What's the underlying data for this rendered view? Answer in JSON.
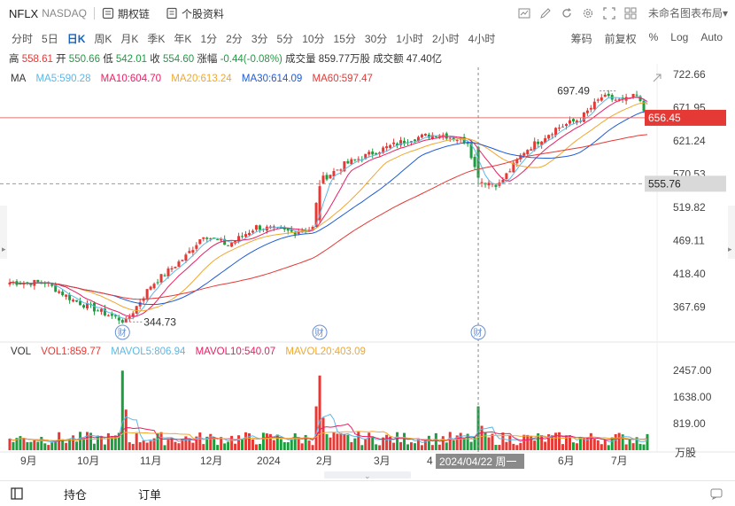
{
  "header": {
    "symbol": "NFLX",
    "exchange": "NASDAQ",
    "link1": "期权链",
    "link2": "个股资料",
    "layout_name": "未命名图表布局"
  },
  "periods": [
    "分时",
    "5日",
    "日K",
    "周K",
    "月K",
    "季K",
    "年K",
    "1分",
    "2分",
    "3分",
    "5分",
    "10分",
    "15分",
    "30分",
    "1小时",
    "2小时",
    "4小时"
  ],
  "active_period": "日K",
  "right_tools": [
    "筹码",
    "前复权",
    "%",
    "Log",
    "Auto"
  ],
  "ohlc": {
    "high_label": "高",
    "high": "558.61",
    "open_label": "开",
    "open": "550.66",
    "low_label": "低",
    "low": "542.01",
    "close_label": "收",
    "close": "554.60",
    "chg_label": "涨幅",
    "chg": "-0.44(-0.08%)",
    "vol_label": "成交量",
    "vol": "859.77万股",
    "amt_label": "成交额",
    "amt": "47.40亿"
  },
  "ma_legend": {
    "title": "MA",
    "ma5": "MA5:590.28",
    "ma10": "MA10:604.70",
    "ma20": "MA20:613.24",
    "ma30": "MA30:614.09",
    "ma60": "MA60:597.47"
  },
  "vol_legend": {
    "title": "VOL",
    "vol1": "VOL1:859.77",
    "mavol5": "MAVOL5:806.94",
    "mavol10": "MAVOL10:540.07",
    "mavol20": "MAVOL20:403.09"
  },
  "bottom": {
    "positions": "持仓",
    "orders": "订单"
  },
  "colors": {
    "up": "#e53935",
    "down": "#1b9e3e",
    "ma5": "#5cb8e6",
    "ma10": "#e91e63",
    "ma20": "#f0a830",
    "ma30": "#1e5bd6",
    "ma60": "#e53935",
    "accent": "#1565c0"
  },
  "chart_data": {
    "type": "candlestick",
    "price_axis_ticks": [
      "722.66",
      "671.95",
      "621.24",
      "570.53",
      "519.82",
      "469.11",
      "418.40",
      "367.69"
    ],
    "volume_axis_ticks": [
      "2457.00",
      "1638.00",
      "819.00"
    ],
    "volume_unit": "万股",
    "x_labels": [
      "9月",
      "10月",
      "11月",
      "12月",
      "2024",
      "2月",
      "3月",
      "4",
      "6月",
      "7月"
    ],
    "price_range": [
      330,
      730
    ],
    "volume_range": [
      0,
      2900
    ],
    "annotations": {
      "high": "697.49",
      "low": "344.73",
      "current_price": "656.45",
      "cursor_price": "555.76",
      "cursor_date": "2024/04/22 周一",
      "earnings_marker": "财"
    },
    "key_prices": [
      {
        "i": 0,
        "v": 405
      },
      {
        "i": 10,
        "v": 405
      },
      {
        "i": 18,
        "v": 378
      },
      {
        "i": 26,
        "v": 360
      },
      {
        "i": 33,
        "v": 345
      },
      {
        "i": 40,
        "v": 400
      },
      {
        "i": 50,
        "v": 445
      },
      {
        "i": 55,
        "v": 478
      },
      {
        "i": 62,
        "v": 462
      },
      {
        "i": 70,
        "v": 490
      },
      {
        "i": 80,
        "v": 482
      },
      {
        "i": 86,
        "v": 488
      },
      {
        "i": 88,
        "v": 560
      },
      {
        "i": 95,
        "v": 585
      },
      {
        "i": 104,
        "v": 605
      },
      {
        "i": 114,
        "v": 625
      },
      {
        "i": 122,
        "v": 632
      },
      {
        "i": 130,
        "v": 620
      },
      {
        "i": 133,
        "v": 560
      },
      {
        "i": 139,
        "v": 555
      },
      {
        "i": 146,
        "v": 605
      },
      {
        "i": 155,
        "v": 640
      },
      {
        "i": 162,
        "v": 655
      },
      {
        "i": 168,
        "v": 688
      },
      {
        "i": 174,
        "v": 682
      },
      {
        "i": 178,
        "v": 690
      },
      {
        "i": 181,
        "v": 656
      }
    ],
    "volume_spikes": [
      {
        "i": 32,
        "v": 2450
      },
      {
        "i": 33,
        "v": 1250
      },
      {
        "i": 88,
        "v": 2300
      },
      {
        "i": 87,
        "v": 1350
      },
      {
        "i": 89,
        "v": 1000
      },
      {
        "i": 133,
        "v": 1350
      },
      {
        "i": 134,
        "v": 750
      }
    ]
  }
}
